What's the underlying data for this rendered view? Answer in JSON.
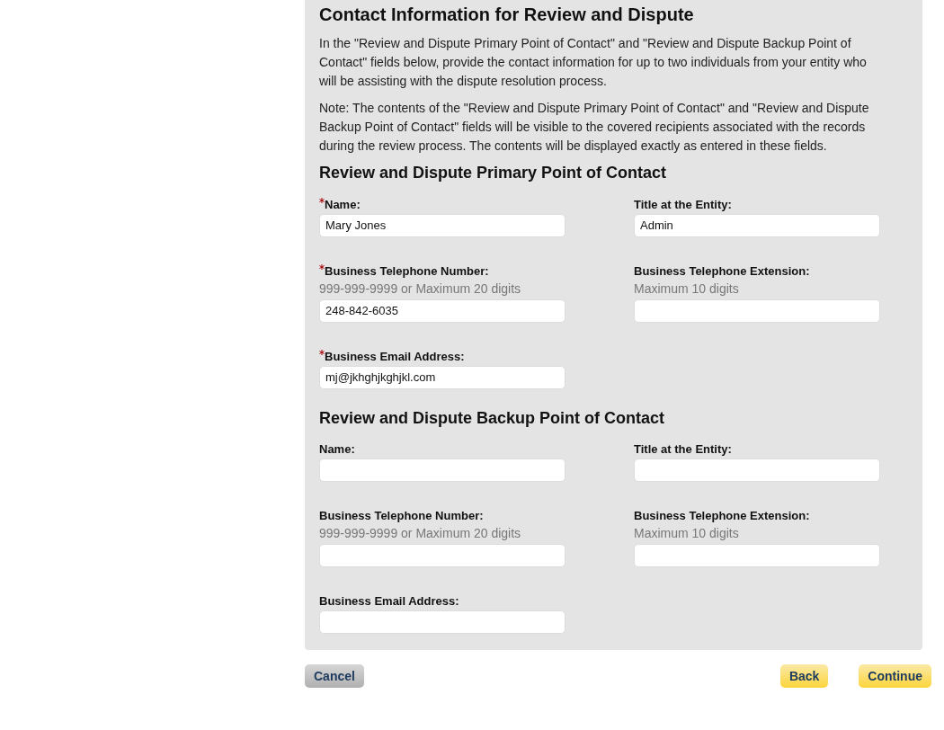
{
  "title": "Contact Information for Review and Dispute",
  "intro": [
    "In the \"Review and Dispute Primary Point of Contact\" and \"Review and Dispute Backup Point of Contact\" fields below, provide the contact information for up to two individuals from your entity who will be assisting with the dispute resolution process.",
    "Note: The contents of the \"Review and Dispute Primary Point of Contact\" and \"Review and Dispute Backup Point of Contact\" fields will be visible to the covered recipients associated with the records during the review process. The contents will be displayed exactly as entered in these fields."
  ],
  "sections": [
    {
      "heading": "Review and Dispute Primary Point of Contact",
      "rows": [
        [
          {
            "label": "Name:",
            "required": true,
            "value": "Mary Jones"
          },
          {
            "label": "Title at the Entity:",
            "required": false,
            "value": "Admin"
          }
        ],
        [
          {
            "label": "Business Telephone Number:",
            "required": true,
            "hint": "999-999-9999 or Maximum 20 digits",
            "value": "248-842-6035"
          },
          {
            "label": "Business Telephone Extension:",
            "required": false,
            "hint": "Maximum 10 digits"
          }
        ],
        [
          {
            "label": "Business Email Address:",
            "required": true,
            "value": "mj@jkhghjkghjkl.com"
          }
        ]
      ]
    },
    {
      "heading": "Review and Dispute Backup Point of Contact",
      "rows": [
        [
          {
            "label": "Name:",
            "required": false
          },
          {
            "label": "Title at the Entity:",
            "required": false
          }
        ],
        [
          {
            "label": "Business Telephone Number:",
            "required": false,
            "hint": "999-999-9999 or Maximum 20 digits"
          },
          {
            "label": "Business Telephone Extension:",
            "required": false,
            "hint": "Maximum 10 digits"
          }
        ],
        [
          {
            "label": "Business Email Address:",
            "required": false
          }
        ]
      ]
    }
  ],
  "buttons": [
    {
      "label": "Cancel",
      "kind": "secondary"
    },
    {
      "label": "Back",
      "kind": "primary"
    },
    {
      "label": "Continue",
      "kind": "primary"
    }
  ]
}
